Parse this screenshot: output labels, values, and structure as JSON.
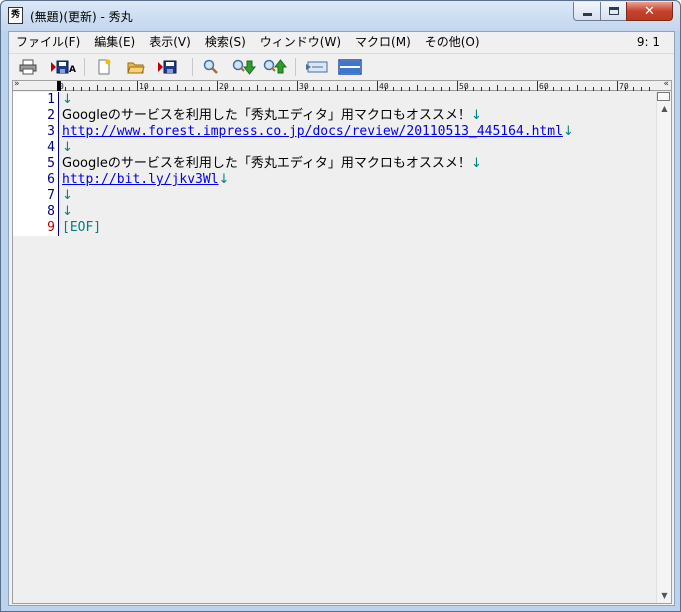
{
  "window": {
    "title": "(無題)(更新) - 秀丸",
    "app_icon_text": "秀",
    "minimize_icon": "minimize-icon",
    "maximize_icon": "maximize-icon",
    "close_icon": "close-icon"
  },
  "menu": {
    "items": [
      {
        "label": "ファイル(F)"
      },
      {
        "label": "編集(E)"
      },
      {
        "label": "表示(V)"
      },
      {
        "label": "検索(S)"
      },
      {
        "label": "ウィンドウ(W)"
      },
      {
        "label": "マクロ(M)"
      },
      {
        "label": "その他(O)"
      }
    ],
    "cursor_position": "9: 1"
  },
  "toolbar": {
    "buttons": [
      {
        "icon": "print-icon"
      },
      {
        "icon": "save-as-icon"
      },
      {
        "icon": "new-file-icon"
      },
      {
        "icon": "open-folder-icon"
      },
      {
        "icon": "save-icon"
      },
      {
        "icon": "search-icon"
      },
      {
        "icon": "search-down-icon"
      },
      {
        "icon": "search-up-icon"
      },
      {
        "icon": "jump-icon"
      },
      {
        "icon": "split-window-icon"
      }
    ]
  },
  "ruler": {
    "corner": "»",
    "right_marker": "«",
    "ticks": [
      "0",
      "10",
      "20",
      "30",
      "40",
      "50",
      "60",
      "70"
    ]
  },
  "editor": {
    "current_line": "9",
    "lines": [
      {
        "no": "1",
        "text": "",
        "newline": "↓"
      },
      {
        "no": "2",
        "text": "Googleのサービスを利用した「秀丸エディタ」用マクロもオススメ！",
        "newline": "↓"
      },
      {
        "no": "3",
        "url": "http://www.forest.impress.co.jp/docs/review/20110513_445164.html",
        "newline": "↓"
      },
      {
        "no": "4",
        "text": "",
        "newline": "↓"
      },
      {
        "no": "5",
        "text": "Googleのサービスを利用した「秀丸エディタ」用マクロもオススメ！",
        "newline": "↓"
      },
      {
        "no": "6",
        "url": "http://bit.ly/jkv3Wl",
        "newline": "↓"
      },
      {
        "no": "7",
        "text": "",
        "newline": "↓"
      },
      {
        "no": "8",
        "text": "",
        "newline": "↓"
      },
      {
        "no": "9",
        "eof": "[EOF]"
      }
    ]
  },
  "colors": {
    "line_number": "#000080",
    "current_line_number": "#c00000",
    "newline_mark": "#008080",
    "url": "#0000ee",
    "eof": "#008080"
  }
}
